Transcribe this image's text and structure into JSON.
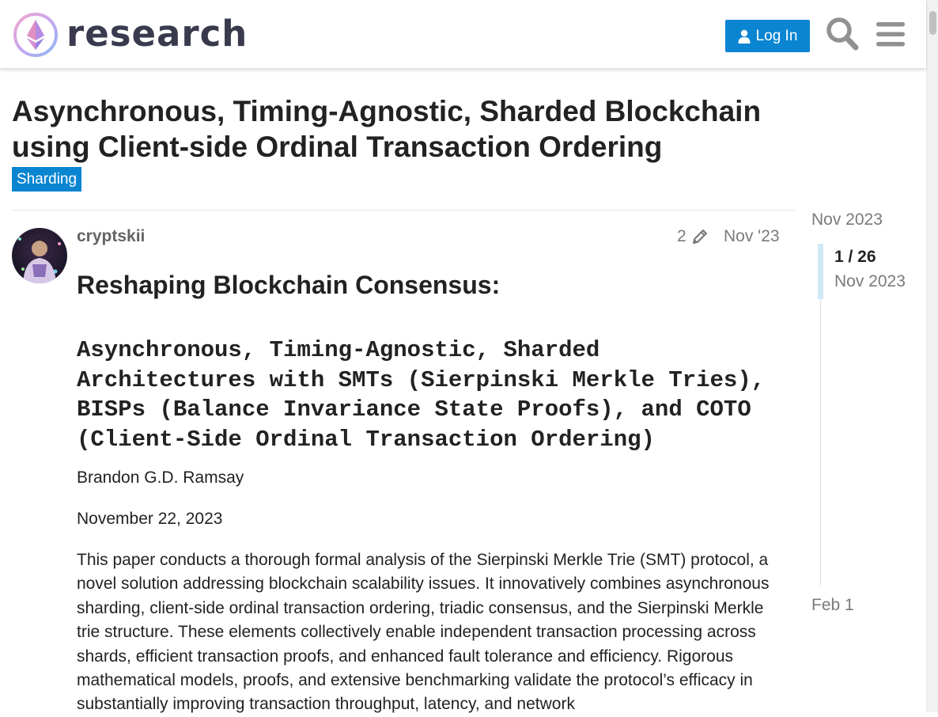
{
  "header": {
    "site_name": "research",
    "login_label": "Log In"
  },
  "topic": {
    "title": "Asynchronous, Timing-Agnostic, Sharded Blockchain using Client-side Ordinal Transaction Ordering",
    "category": "Sharding",
    "category_color": "#0a85d1"
  },
  "post": {
    "username": "cryptskii",
    "edit_count": "2",
    "date": "Nov '23",
    "heading": "Reshaping Blockchain Consensus:",
    "subheading": "Asynchronous, Timing-Agnostic, Sharded Architectures with SMTs (Sierpinski Merkle Tries), BISPs (Balance Invariance State Proofs), and COTO (Client-Side Ordinal Transaction Ordering)",
    "author": "Brandon G.D. Ramsay",
    "paper_date": "November 22, 2023",
    "abstract": "This paper conducts a thorough formal analysis of the Sierpinski Merkle Trie (SMT) protocol, a novel solution addressing blockchain scalability issues. It innovatively combines asynchronous sharding, client-side ordinal transaction ordering, triadic consensus, and the Sierpinski Merkle trie structure. These elements collectively enable independent transaction processing across shards, efficient transaction proofs, and enhanced fault tolerance and efficiency. Rigorous mathematical models, proofs, and extensive benchmarking validate the protocol’s efficacy in substantially improving transaction throughput, latency, and network"
  },
  "timeline": {
    "start_label": "Nov 2023",
    "position": "1 / 26",
    "position_date": "Nov 2023",
    "end_label": "Feb 1"
  },
  "icons": {
    "logo": "ethereum-research-logo",
    "user": "user-icon",
    "search": "search-icon",
    "menu": "hamburger-menu-icon",
    "edit": "pencil-icon"
  },
  "colors": {
    "accent": "#0a85d1",
    "muted_text": "#7a7a7a"
  }
}
